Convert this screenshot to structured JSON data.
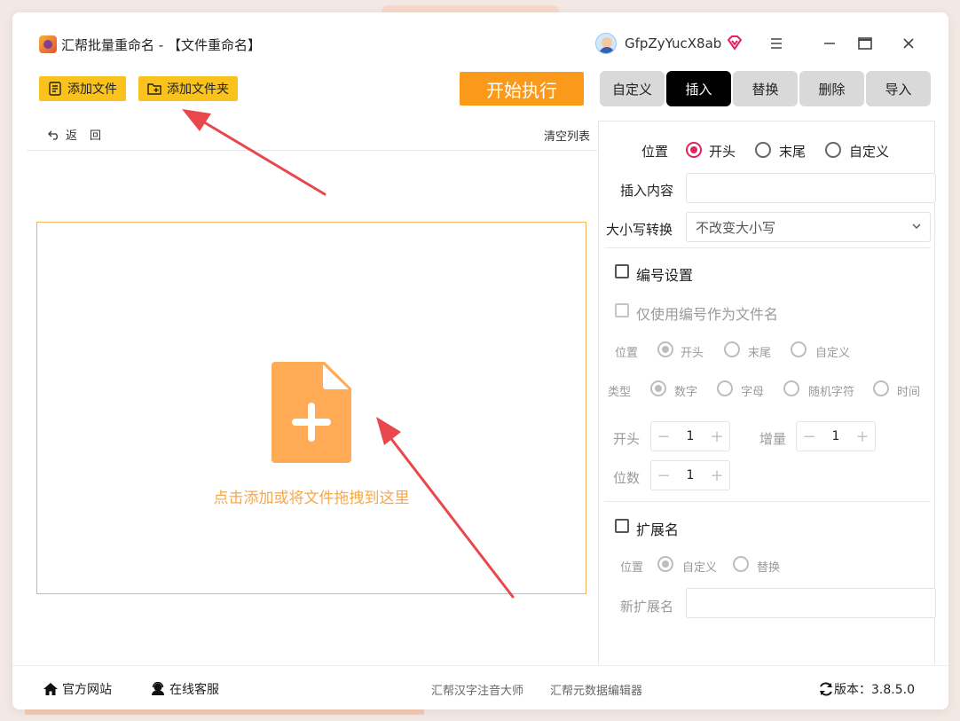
{
  "window": {
    "title": "汇帮批量重命名 - 【文件重命名】",
    "username": "GfpZyYucX8ab"
  },
  "toolbar": {
    "add_file": "添加文件",
    "add_folder": "添加文件夹",
    "start": "开始执行"
  },
  "tabs": [
    {
      "label": "自定义",
      "active": false
    },
    {
      "label": "插入",
      "active": true
    },
    {
      "label": "替换",
      "active": false
    },
    {
      "label": "删除",
      "active": false
    },
    {
      "label": "导入",
      "active": false
    }
  ],
  "list": {
    "back": "返回",
    "clear": "清空列表",
    "drop_hint": "点击添加或将文件拖拽到这里"
  },
  "insert": {
    "position_label": "位置",
    "position_options": [
      "开头",
      "末尾",
      "自定义"
    ],
    "position_selected": "开头",
    "content_label": "插入内容",
    "content_value": "",
    "case_label": "大小写转换",
    "case_value": "不改变大小写"
  },
  "numbering": {
    "title": "编号设置",
    "enabled": false,
    "only_number": "仅使用编号作为文件名",
    "position_label": "位置",
    "position_options": [
      "开头",
      "末尾",
      "自定义"
    ],
    "type_label": "类型",
    "type_options": [
      "数字",
      "字母",
      "随机字符",
      "时间"
    ],
    "start_label": "开头",
    "start_value": "1",
    "step_label": "增量",
    "step_value": "1",
    "digits_label": "位数",
    "digits_value": "1"
  },
  "extension": {
    "title": "扩展名",
    "enabled": false,
    "position_label": "位置",
    "position_options": [
      "自定义",
      "替换"
    ],
    "new_ext_label": "新扩展名",
    "new_ext_value": ""
  },
  "footer": {
    "website": "官方网站",
    "support": "在线客服",
    "link1": "汇帮汉字注音大师",
    "link2": "汇帮元数据编辑器",
    "version": "版本：3.8.5.0"
  },
  "colors": {
    "accent_yellow": "#f9c21c",
    "start_orange": "#fb9a1a",
    "radio_pink": "#e0245e",
    "drop_orange": "#f5a84c",
    "arrow_red": "#e8484c"
  }
}
